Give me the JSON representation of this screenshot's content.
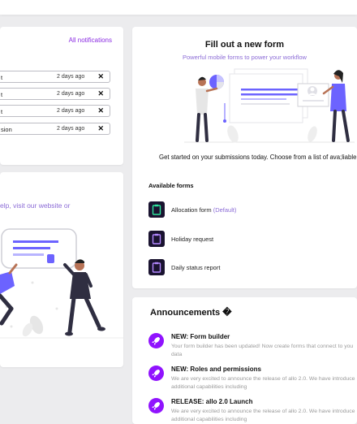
{
  "notifications": {
    "all_link": "All notifications",
    "items": [
      {
        "title": "t",
        "time": "2 days ago"
      },
      {
        "title": "t",
        "time": "2 days ago"
      },
      {
        "title": "t",
        "time": "2 days ago"
      },
      {
        "title": "sion",
        "time": "2 days ago"
      }
    ],
    "close_glyph": "✕"
  },
  "help": {
    "text": "elp, visit our website or"
  },
  "form_panel": {
    "title": "Fill out a new form",
    "subtitle": "Powerful mobile forms to power your workflow",
    "description": "Get started on your submissions today. Choose from a list of ava;liable",
    "available_label": "Available forms",
    "forms": [
      {
        "name": "Allocation form",
        "tag": "(Default)",
        "icon": "clipboard-icon"
      },
      {
        "name": "Holiday request",
        "tag": "",
        "icon": "clipboard-icon"
      },
      {
        "name": "Daily status report",
        "tag": "",
        "icon": "clipboard-icon"
      }
    ]
  },
  "announcements": {
    "title": "Announcements �",
    "items": [
      {
        "heading": "NEW: Form builder",
        "line1": "Your form builder has been updated! Now create forms that connect to you",
        "line2": "data",
        "icon": "rocket-icon"
      },
      {
        "heading": "NEW: Roles and permissions",
        "line1": "We are very excited to announce the release of allo 2.0. We have introduce",
        "line2": "additional capabilities including",
        "icon": "rocket-icon"
      },
      {
        "heading": "RELEASE: allo 2.0 Launch",
        "line1": "We are very excited to announce the release of allo 2.0. We have introduce",
        "line2": "additional capabilities including",
        "icon": "rocket-icon"
      }
    ]
  },
  "colors": {
    "accent": "#9013fe",
    "link": "#8a2be2",
    "muted_purple": "#8b6bd6",
    "icon_dark": "#1a1330",
    "icon_green": "#2ee59d"
  }
}
